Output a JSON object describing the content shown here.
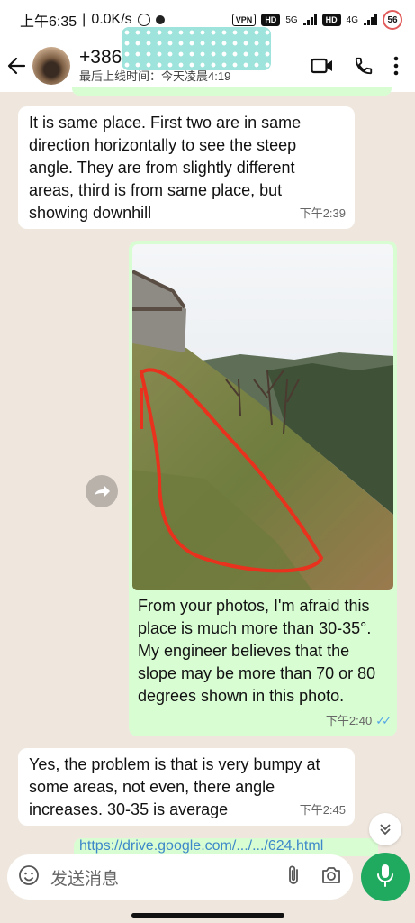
{
  "status_bar": {
    "time": "上午6:35",
    "net_speed": "0.0K/s",
    "vpn": "VPN",
    "hd1": "HD",
    "net1": "5G",
    "hd2": "HD",
    "net2": "4G",
    "battery": "56"
  },
  "header": {
    "contact_name": "+386 4",
    "last_seen": "最后上线时间：今天凌晨4:19"
  },
  "messages": [
    {
      "direction": "incoming",
      "text": "It is same place. First two are in same direction horizontally to see the steep angle. They are from slightly different areas, third is from same place, but showing downhill",
      "time": "下午2:39"
    },
    {
      "direction": "outgoing",
      "caption": "From your photos, I'm afraid this place is much more than 30-35°. My engineer believes that the slope may be more than 70 or 80 degrees shown in this photo.",
      "time": "下午2:40",
      "read": true
    },
    {
      "direction": "incoming",
      "text": "Yes, the problem is that is very bumpy at some areas, not even, there angle increases. 30-35 is average",
      "time": "下午2:45"
    }
  ],
  "next_message_peek": "https://drive.google.com/.../.../624.html",
  "input": {
    "placeholder": "发送消息"
  },
  "colors": {
    "outgoing_bubble": "#d9fdd3",
    "incoming_bubble": "#ffffff",
    "chat_background": "#efe7de",
    "mic_button": "#1faa5f",
    "read_ticks": "#53a6e6",
    "redaction_mask": "#9ee3dc"
  }
}
